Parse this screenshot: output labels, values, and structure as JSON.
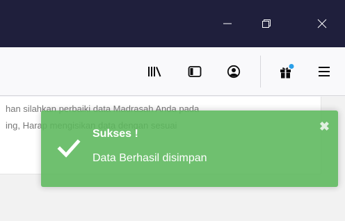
{
  "window": {
    "minimize_icon": "minimize-icon",
    "restore_icon": "restore-icon",
    "close_icon": "close-icon"
  },
  "toolbar": {
    "icons": [
      "library-icon",
      "sidebar-icon",
      "account-icon",
      "gift-icon",
      "menu-icon"
    ],
    "badge_color": "#2a9fe8"
  },
  "page": {
    "line1": "han silahkan perbaiki data Madrasah Anda pada",
    "line2": "ing, Harap mengisikan data dengan sesuai"
  },
  "toast": {
    "title": "Sukses !",
    "message": "Data Berhasil disimpan",
    "close_symbol": "✖",
    "color": "#5cb85c"
  }
}
